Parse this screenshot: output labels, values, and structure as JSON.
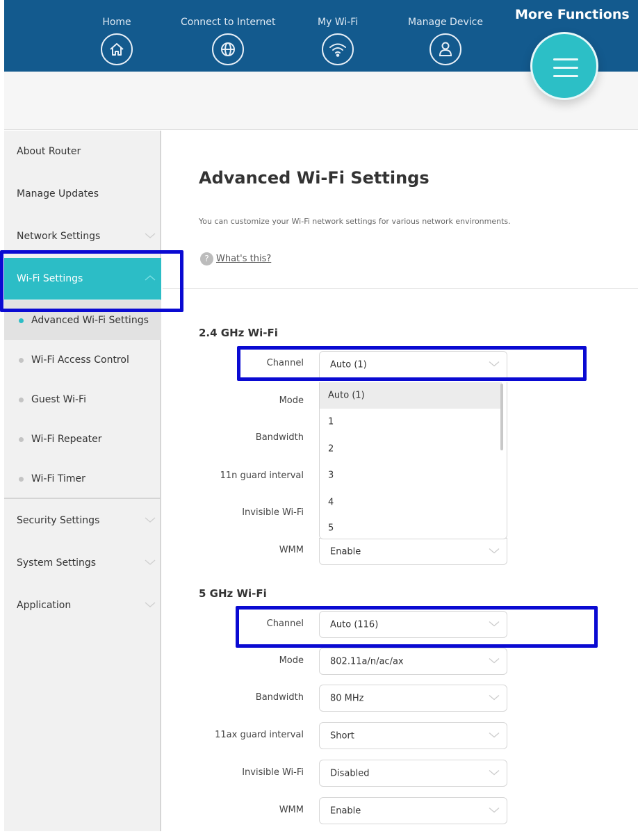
{
  "topnav": {
    "items": [
      {
        "label": "Home",
        "icon": "home-icon"
      },
      {
        "label": "Connect to Internet",
        "icon": "globe-icon"
      },
      {
        "label": "My Wi-Fi",
        "icon": "wifi-icon"
      },
      {
        "label": "Manage Device",
        "icon": "user-icon"
      }
    ],
    "more_label": "More Functions",
    "more_icon": "menu-icon"
  },
  "sidebar": {
    "items": [
      {
        "label": "About Router"
      },
      {
        "label": "Manage Updates"
      },
      {
        "label": "Network Settings",
        "icon": "chevron-down-icon"
      },
      {
        "label": "Wi-Fi Settings",
        "icon": "chevron-up-icon",
        "active": true
      },
      {
        "label": "Security Settings",
        "icon": "chevron-down-icon"
      },
      {
        "label": "System Settings",
        "icon": "chevron-down-icon"
      },
      {
        "label": "Application",
        "icon": "chevron-down-icon"
      }
    ],
    "wifi_subitems": [
      {
        "label": "Advanced Wi-Fi Settings",
        "active": true
      },
      {
        "label": "Wi-Fi Access Control"
      },
      {
        "label": "Guest Wi-Fi"
      },
      {
        "label": "Wi-Fi Repeater"
      },
      {
        "label": "Wi-Fi Timer"
      }
    ]
  },
  "main": {
    "title": "Advanced Wi-Fi Settings",
    "description": "You can customize your Wi-Fi network settings for various network environments.",
    "help_icon": "question-icon",
    "help_link": "What's this?",
    "band24": {
      "title": "2.4 GHz Wi-Fi",
      "rows": [
        {
          "label": "Channel",
          "value": "Auto (1)"
        },
        {
          "label": "Mode",
          "value": ""
        },
        {
          "label": "Bandwidth",
          "value": ""
        },
        {
          "label": "11n guard interval",
          "value": ""
        },
        {
          "label": "Invisible Wi-Fi",
          "value": ""
        },
        {
          "label": "WMM",
          "value": "Enable"
        }
      ],
      "channel_dropdown": {
        "open": true,
        "options": [
          "Auto (1)",
          "1",
          "2",
          "3",
          "4",
          "5"
        ],
        "highlighted": "Auto (1)"
      }
    },
    "band5": {
      "title": "5 GHz Wi-Fi",
      "rows": [
        {
          "label": "Channel",
          "value": "Auto (116)"
        },
        {
          "label": "Mode",
          "value": "802.11a/n/ac/ax"
        },
        {
          "label": "Bandwidth",
          "value": "80 MHz"
        },
        {
          "label": "11ax guard interval",
          "value": "Short"
        },
        {
          "label": "Invisible Wi-Fi",
          "value": "Disabled"
        },
        {
          "label": "WMM",
          "value": "Enable"
        }
      ]
    }
  },
  "colors": {
    "header": "#135a8e",
    "accent": "#2cbdc6",
    "annotation_box": "#0a0ad2"
  }
}
